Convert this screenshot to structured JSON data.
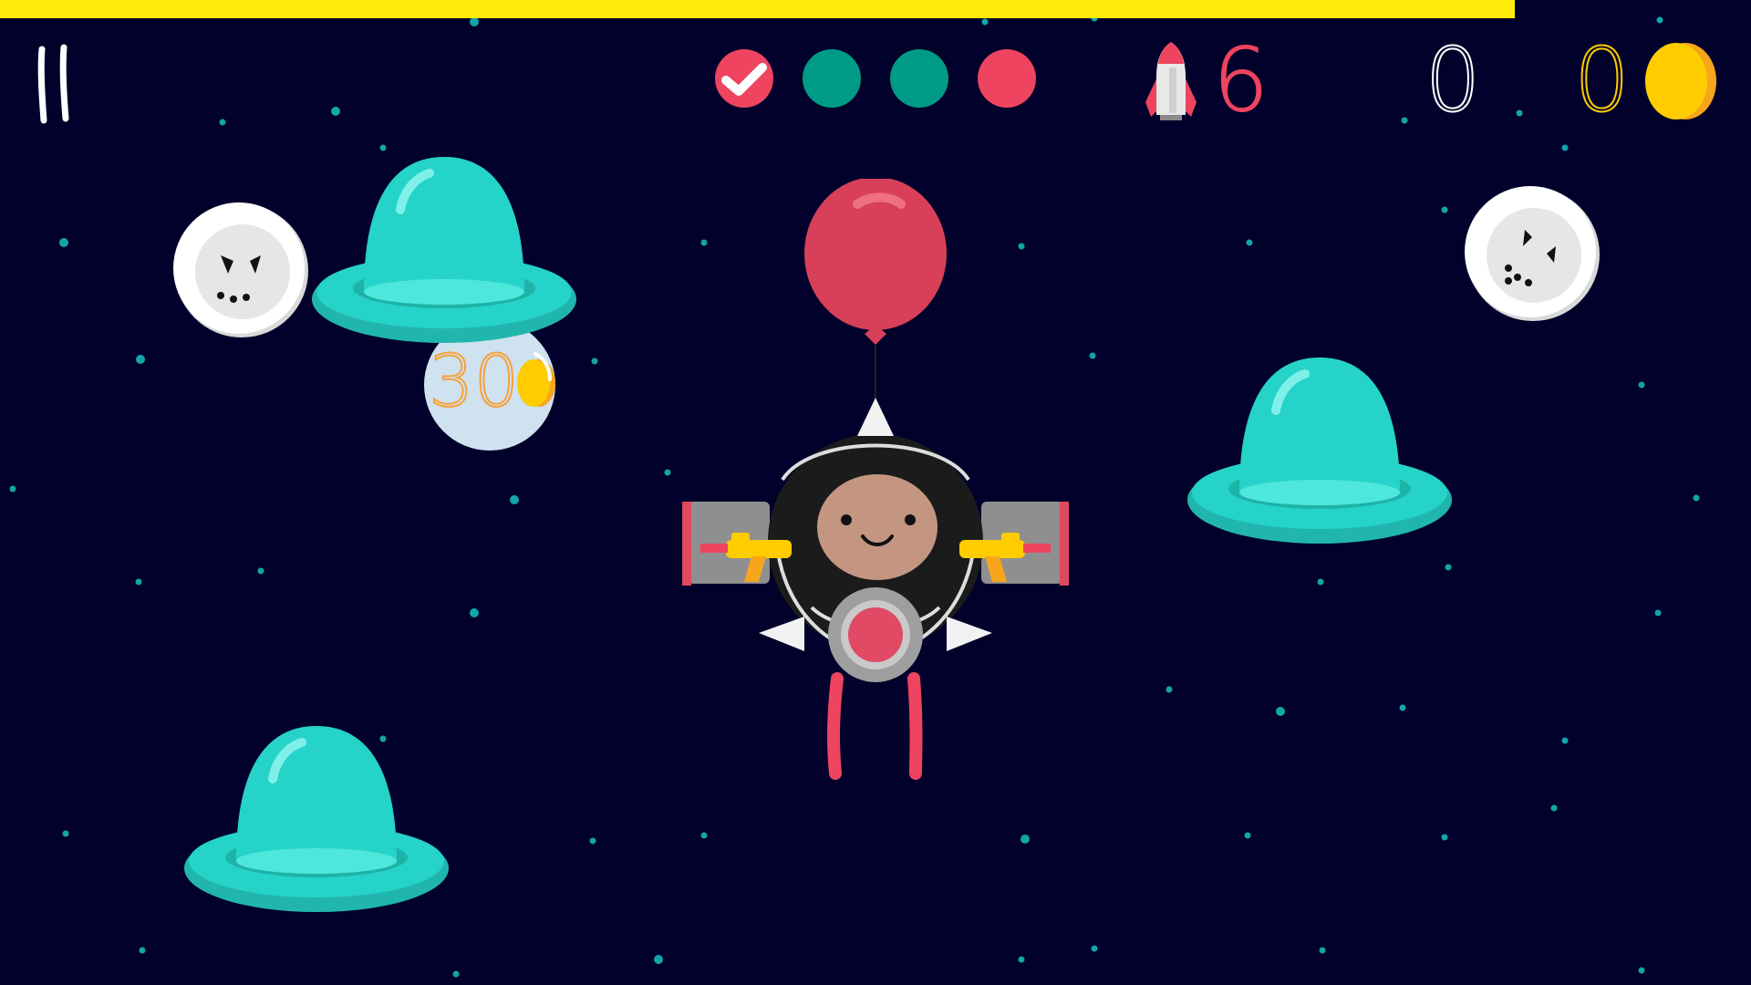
{
  "game": {
    "level_progress_pct": 86.5,
    "colors": {
      "background": "#02012b",
      "progress": "#ffeb0a",
      "ufo": "#25d3c8",
      "balloon": "#d8405a",
      "accent_red": "#ee4460",
      "teal_dot": "#009b86",
      "coin": "#ffcc00"
    }
  },
  "hud": {
    "pause_icon": "pause-icon",
    "lives": [
      {
        "state": "done",
        "color": "#ee4460"
      },
      {
        "state": "active",
        "color": "#009b86"
      },
      {
        "state": "active",
        "color": "#009b86"
      },
      {
        "state": "active",
        "color": "#ee4460"
      }
    ],
    "rocket_icon": "rocket-icon",
    "rockets_remaining": "6",
    "score": "0",
    "coins": "0",
    "coin_icon": "coin-icon"
  },
  "entities": {
    "bubble_reward": "30",
    "moons": [
      "moon-left",
      "moon-right"
    ],
    "ufos": [
      "ufo-top-left",
      "ufo-right",
      "ufo-bottom-left"
    ],
    "player": {
      "name": "astronaut",
      "balloon": "red-balloon",
      "weapons": "water-guns",
      "jetpack": "jetpack"
    }
  }
}
